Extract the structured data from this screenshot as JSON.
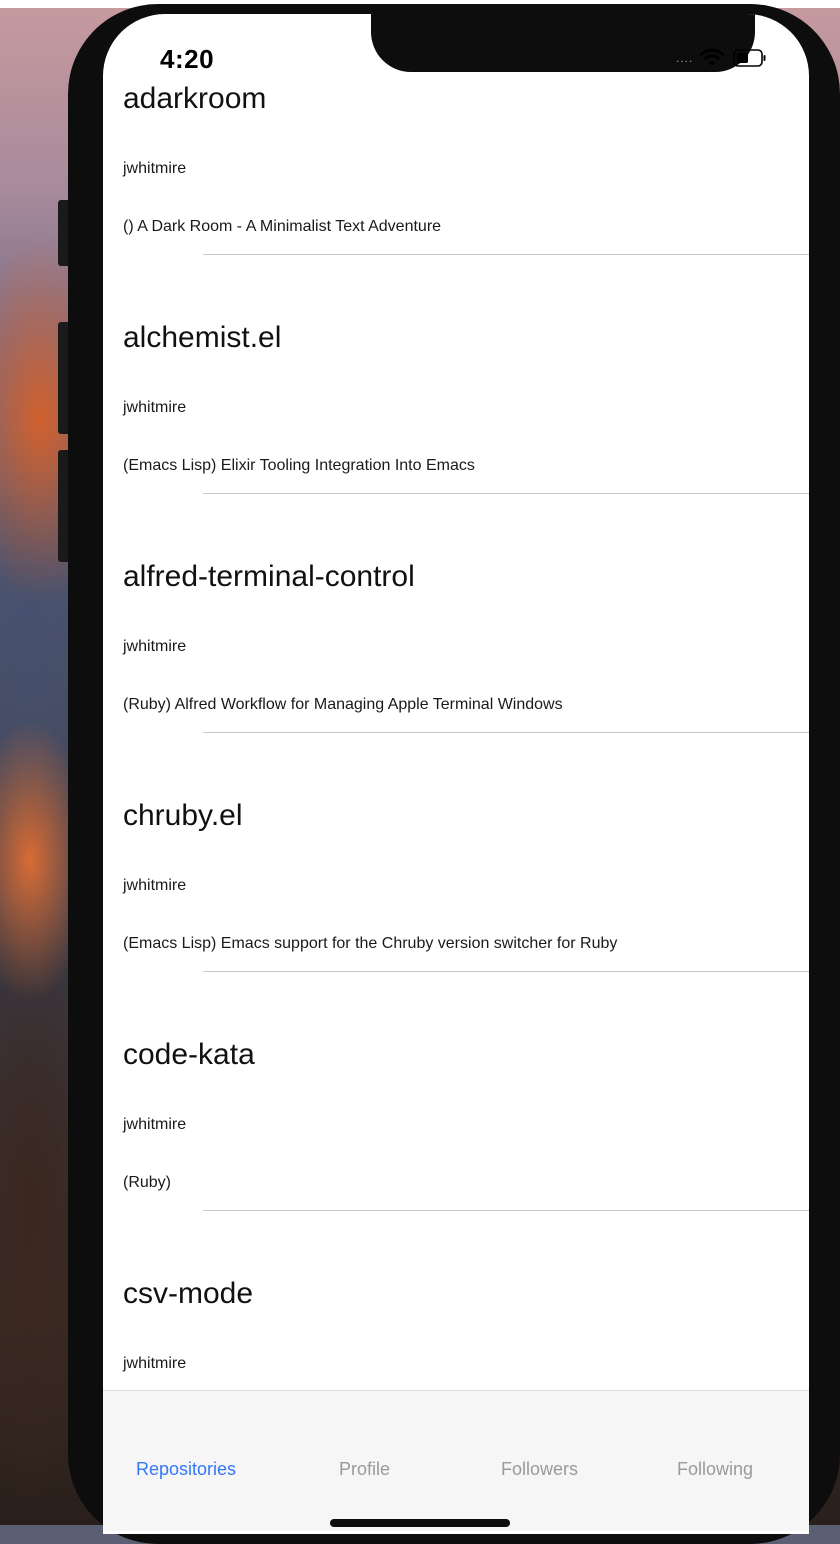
{
  "status_bar": {
    "time": "4:20",
    "signal": "....",
    "wifi_icon": "wifi-icon",
    "battery_icon": "battery-icon"
  },
  "repositories": [
    {
      "name": "adarkroom",
      "owner": "jwhitmire",
      "description": "() A Dark Room - A Minimalist Text Adventure"
    },
    {
      "name": "alchemist.el",
      "owner": "jwhitmire",
      "description": "(Emacs Lisp) Elixir Tooling Integration Into Emacs"
    },
    {
      "name": "alfred-terminal-control",
      "owner": "jwhitmire",
      "description": "(Ruby) Alfred Workflow for Managing Apple Terminal Windows"
    },
    {
      "name": "chruby.el",
      "owner": "jwhitmire",
      "description": "(Emacs Lisp) Emacs support for the Chruby version switcher for Ruby"
    },
    {
      "name": "code-kata",
      "owner": "jwhitmire",
      "description": "(Ruby)"
    },
    {
      "name": "csv-mode",
      "owner": "jwhitmire",
      "description": ""
    }
  ],
  "tabs": [
    {
      "label": "Repositories",
      "active": true
    },
    {
      "label": "Profile",
      "active": false
    },
    {
      "label": "Followers",
      "active": false
    },
    {
      "label": "Following",
      "active": false
    }
  ],
  "colors": {
    "accent": "#3478f6",
    "tab_inactive": "#9a9a9a",
    "separator": "#c8c8c8",
    "tab_bar_background": "#f6f6f6"
  }
}
